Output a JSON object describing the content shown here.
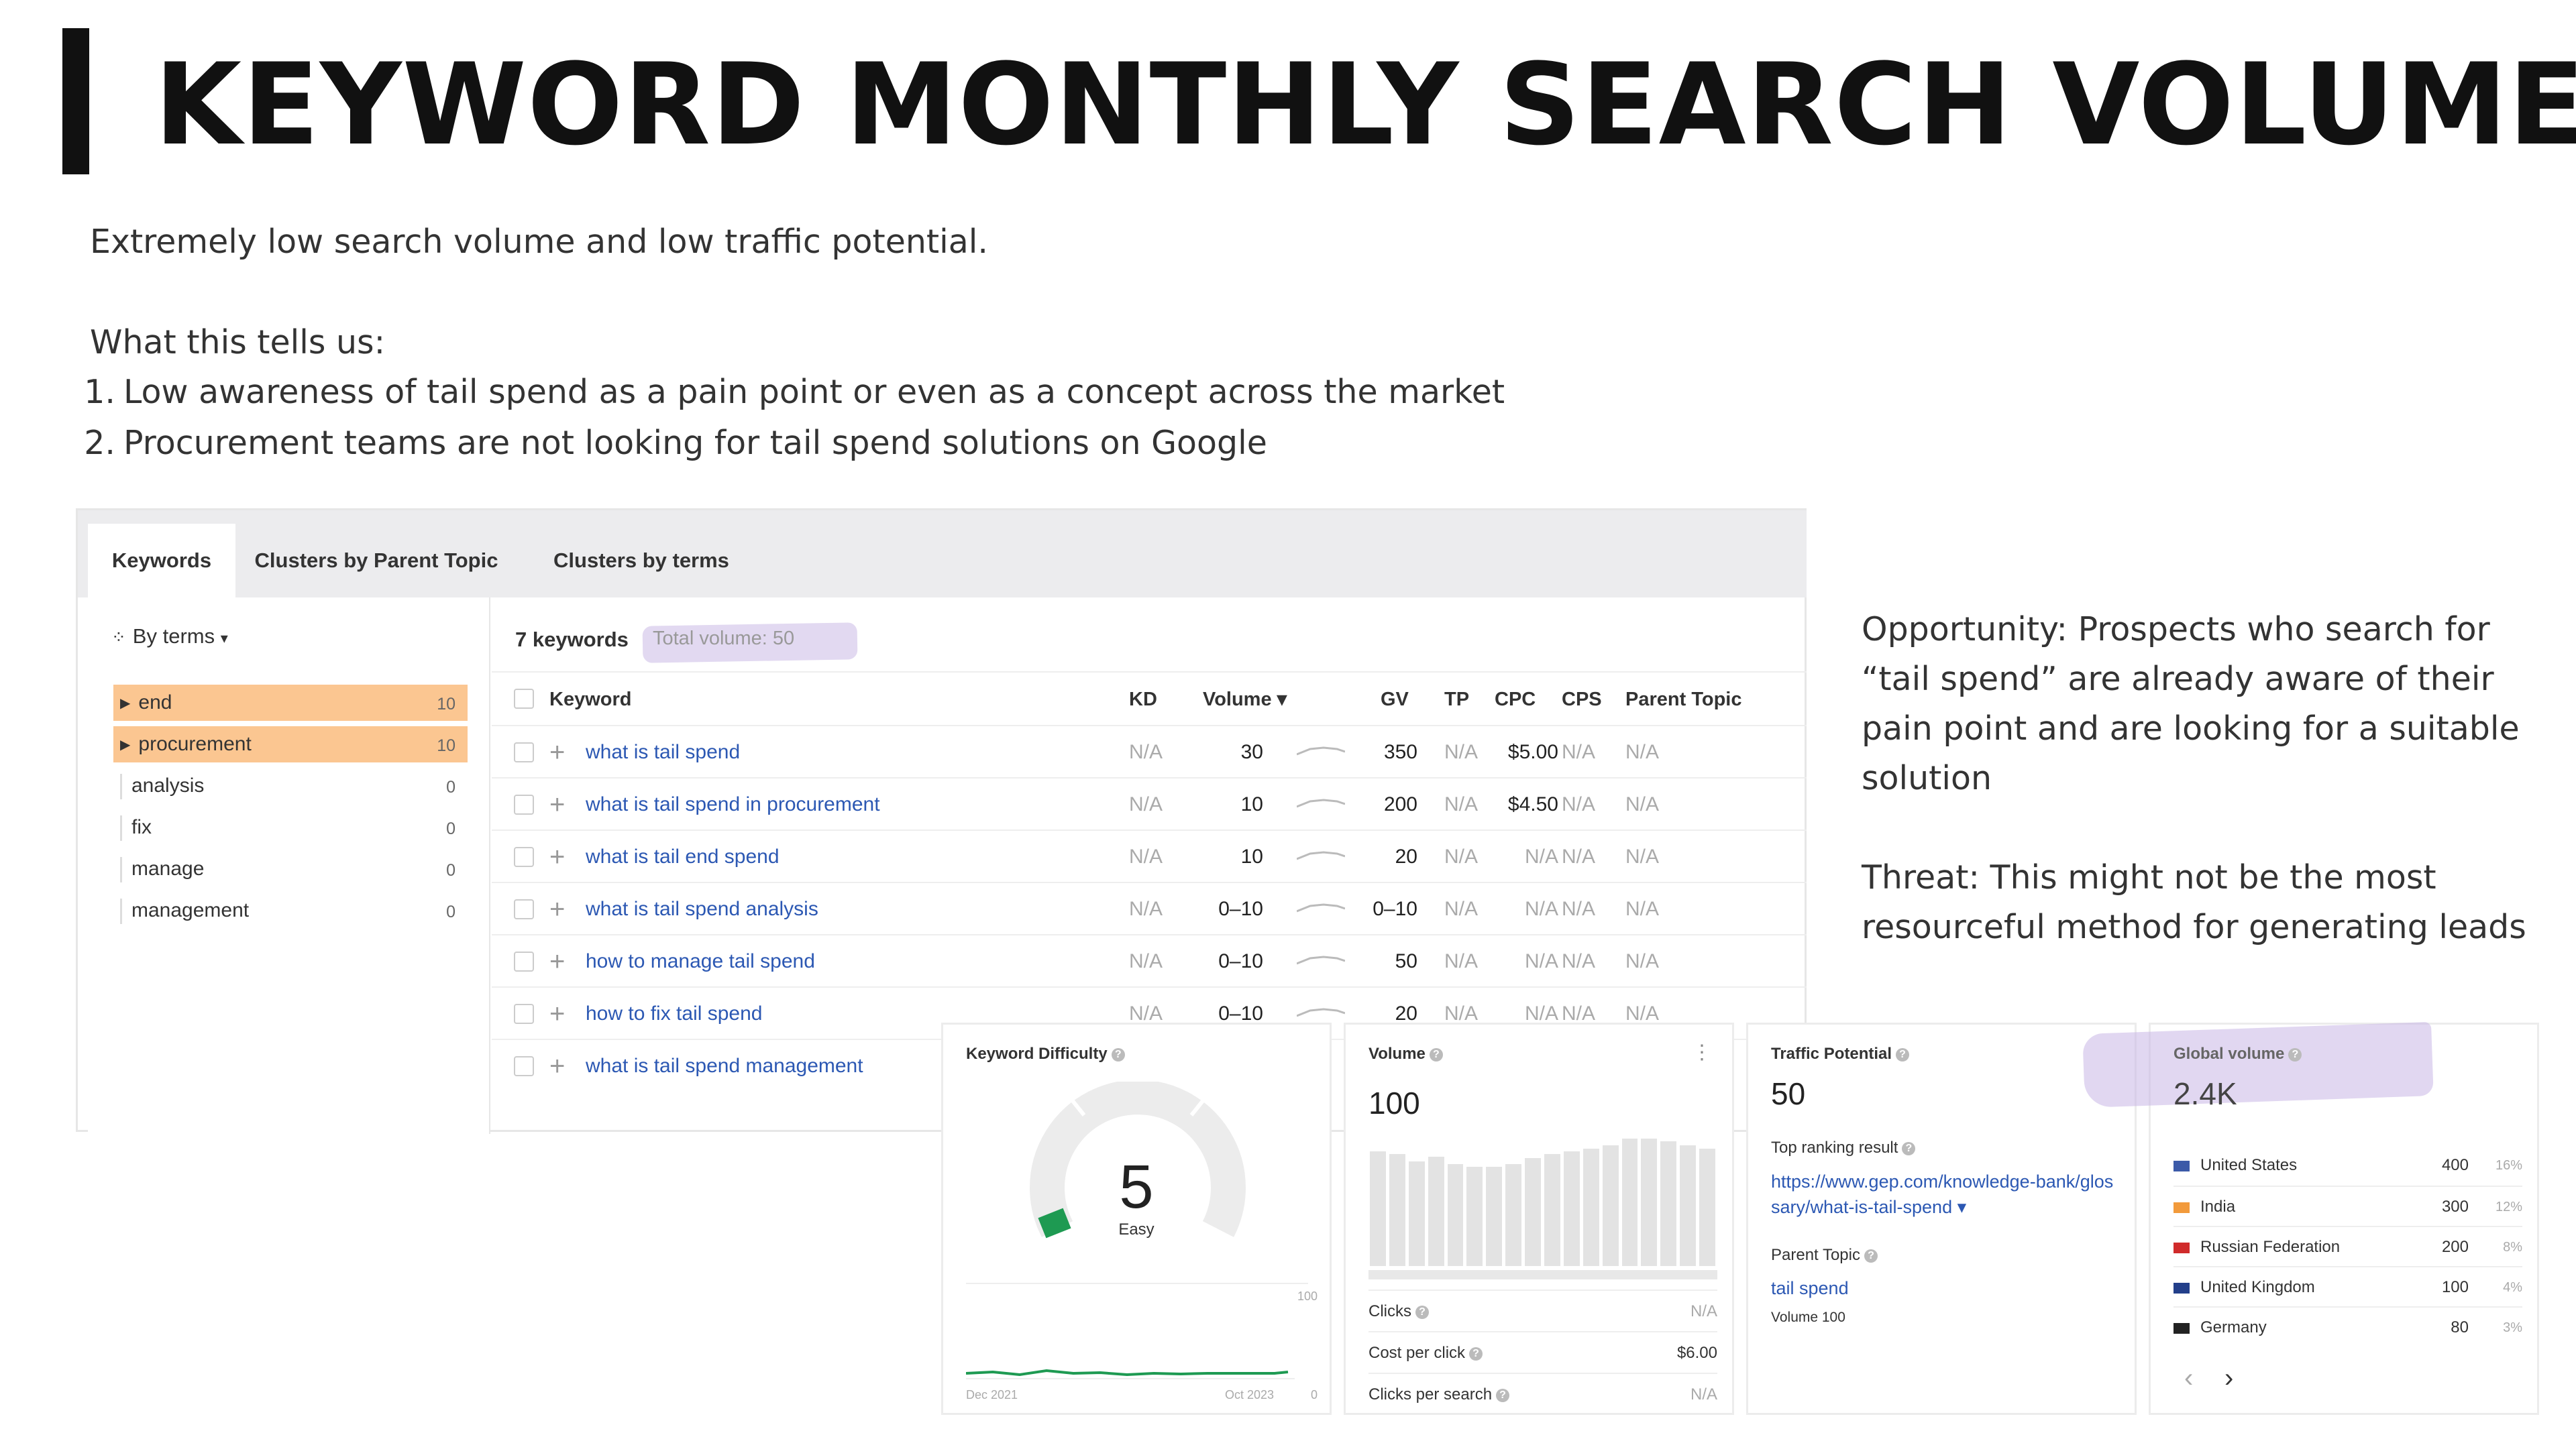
{
  "title": "KEYWORD MONTHLY SEARCH VOLUME",
  "subtitle": "Extremely low search volume and low traffic potential.",
  "tells_heading": "What this tells us:",
  "tells_items": [
    {
      "num": "1.",
      "text": "Low awareness of tail spend as a pain point or even as a concept across the market"
    },
    {
      "num": "2.",
      "text": "Procurement teams are not looking for tail spend solutions on Google"
    }
  ],
  "side_notes": {
    "opportunity": "Opportunity: Prospects who search for “tail spend” are already aware of their pain point and are looking for a suitable solution",
    "threat": "Threat: This might not be the most resourceful method for generating leads"
  },
  "tabs": [
    "Keywords",
    "Clusters by Parent Topic",
    "Clusters by terms"
  ],
  "by_terms_label": "By terms",
  "terms": [
    {
      "label": "end",
      "count": "10",
      "highlight": true
    },
    {
      "label": "procurement",
      "count": "10",
      "highlight": true
    },
    {
      "label": "analysis",
      "count": "0",
      "highlight": false
    },
    {
      "label": "fix",
      "count": "0",
      "highlight": false
    },
    {
      "label": "manage",
      "count": "0",
      "highlight": false
    },
    {
      "label": "management",
      "count": "0",
      "highlight": false
    }
  ],
  "keyword_count": "7 keywords",
  "total_volume": "Total volume: 50",
  "columns": {
    "keyword": "Keyword",
    "kd": "KD",
    "volume": "Volume ▾",
    "gv": "GV",
    "tp": "TP",
    "cpc": "CPC",
    "cps": "CPS",
    "parent": "Parent Topic"
  },
  "rows": [
    {
      "keyword": "what is tail spend",
      "kd": "N/A",
      "volume": "30",
      "gv": "350",
      "tp": "N/A",
      "cpc": "$5.00",
      "cps": "N/A",
      "parent": "N/A"
    },
    {
      "keyword": "what is tail spend in procurement",
      "kd": "N/A",
      "volume": "10",
      "gv": "200",
      "tp": "N/A",
      "cpc": "$4.50",
      "cps": "N/A",
      "parent": "N/A"
    },
    {
      "keyword": "what is tail end spend",
      "kd": "N/A",
      "volume": "10",
      "gv": "20",
      "tp": "N/A",
      "cpc": "N/A",
      "cps": "N/A",
      "parent": "N/A"
    },
    {
      "keyword": "what is tail spend analysis",
      "kd": "N/A",
      "volume": "0–10",
      "gv": "0–10",
      "tp": "N/A",
      "cpc": "N/A",
      "cps": "N/A",
      "parent": "N/A"
    },
    {
      "keyword": "how to manage tail spend",
      "kd": "N/A",
      "volume": "0–10",
      "gv": "50",
      "tp": "N/A",
      "cpc": "N/A",
      "cps": "N/A",
      "parent": "N/A"
    },
    {
      "keyword": "how to fix tail spend",
      "kd": "N/A",
      "volume": "0–10",
      "gv": "20",
      "tp": "N/A",
      "cpc": "N/A",
      "cps": "N/A",
      "parent": "N/A"
    },
    {
      "keyword": "what is tail spend management",
      "kd": "",
      "volume": "",
      "gv": "",
      "tp": "",
      "cpc": "",
      "cps": "",
      "parent": ""
    }
  ],
  "kd_widget": {
    "title": "Keyword Difficulty",
    "value": "5",
    "label": "Easy",
    "chart_max": "100",
    "chart_min": "0",
    "date_start": "Dec 2021",
    "date_end": "Oct 2023",
    "gauge_fraction": 0.05
  },
  "volume_widget": {
    "title": "Volume",
    "value": "100",
    "bars": [
      0.9,
      0.88,
      0.82,
      0.86,
      0.8,
      0.78,
      0.78,
      0.8,
      0.85,
      0.88,
      0.9,
      0.92,
      0.95,
      1.0,
      1.0,
      0.98,
      0.95,
      0.92
    ],
    "metrics": [
      {
        "label": "Clicks",
        "value": "N/A"
      },
      {
        "label": "Cost per click",
        "value": "$6.00"
      },
      {
        "label": "Clicks per search",
        "value": "N/A"
      }
    ]
  },
  "tp_widget": {
    "title": "Traffic Potential",
    "value": "50",
    "top_ranking_label": "Top ranking result",
    "top_ranking_url": "https://www.gep.com/knowledge-bank/glossary/what-is-tail-spend ▾",
    "parent_topic_label": "Parent Topic",
    "parent_topic": "tail spend",
    "parent_volume": "Volume 100"
  },
  "gv_widget": {
    "title": "Global volume",
    "value": "2.4K",
    "countries": [
      {
        "name": "United States",
        "value": "400",
        "pct": "16%",
        "flag": "#3c5aa8"
      },
      {
        "name": "India",
        "value": "300",
        "pct": "12%",
        "flag": "#f29a3b"
      },
      {
        "name": "Russian Federation",
        "value": "200",
        "pct": "8%",
        "flag": "#d02b2b"
      },
      {
        "name": "United Kingdom",
        "value": "100",
        "pct": "4%",
        "flag": "#233f8a"
      },
      {
        "name": "Germany",
        "value": "80",
        "pct": "3%",
        "flag": "#222222"
      }
    ],
    "prev": "‹",
    "next": "›"
  },
  "colors": {
    "accent_orange": "#fbc691",
    "link_blue": "#2c58b3",
    "kd_green": "#1e9a52",
    "highlight_purple": "#c8b6e6"
  }
}
